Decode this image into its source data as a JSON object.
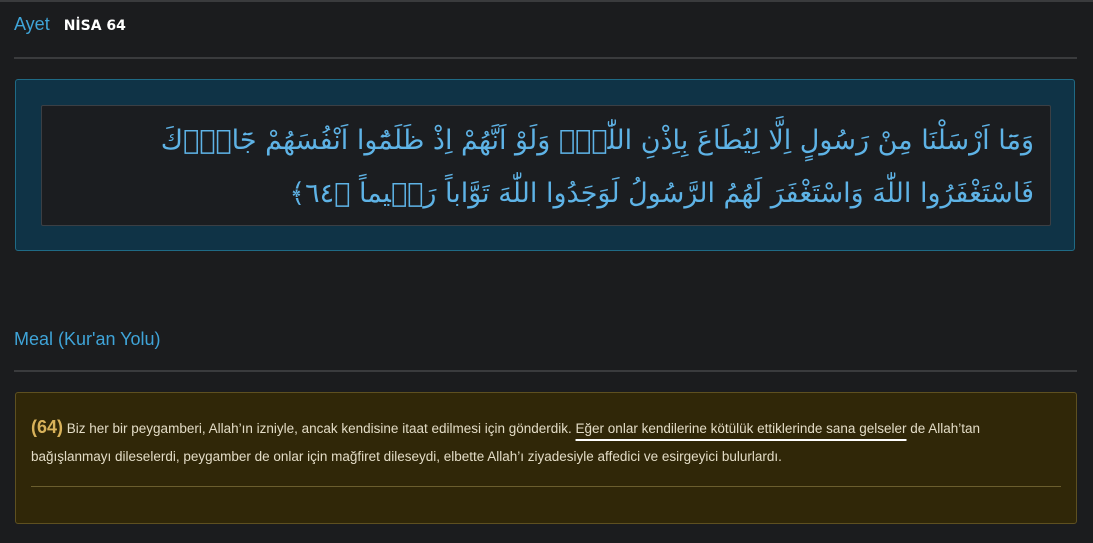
{
  "ayet": {
    "title": "Ayet",
    "reference": "NİSA 64",
    "arabic_text": "وَمَٓا اَرْسَلْنَا مِنْ رَسُولٍ اِلَّا لِيُطَاعَ بِاِذْنِ اللّٰهِۜ وَلَوْ اَنَّهُمْ اِذْ ظَلَمُٓوا اَنْفُسَهُمْ جَٓاؤُ۫كَ فَاسْتَغْفَرُوا اللّٰهَ وَاسْتَغْفَرَ لَهُمُ الرَّسُولُ لَوَجَدُوا اللّٰهَ تَوَّاباً رَح۪يماً",
    "verse_marker": "﴿٦٤﴾"
  },
  "meal": {
    "title": "Meal (Kur'an Yolu)",
    "number": "(64)",
    "text_before": " Biz her bir peygamberi, Allah’ın izniyle, ancak kendisine itaat edilmesi için gönderdik. ",
    "text_highlight": "Eğer onlar kendilerine kötülük ettiklerinde sana gelseler",
    "text_after": " de Allah’tan bağışlanmayı dileselerdi, peygamber de onlar için mağfiret dileseydi, elbette Allah’ı ziyadesiyle affedici ve esirgeyici bulurlardı."
  },
  "colors": {
    "accent": "#3fa4d8",
    "arabic_text": "#5eb3e6",
    "meal_background": "#302708"
  }
}
